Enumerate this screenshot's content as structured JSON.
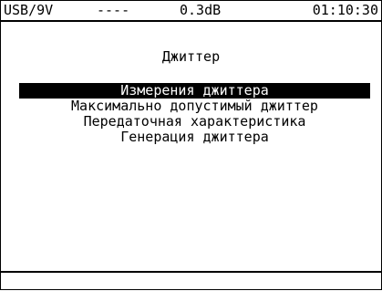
{
  "status": {
    "power": "USB/9V",
    "mode": "----",
    "level": "0.3dB",
    "time": "01:10:30"
  },
  "title": "Джиттер",
  "menu": [
    {
      "label": "Измерения джиттера",
      "selected": true
    },
    {
      "label": "Максимально допустимый джиттер",
      "selected": false
    },
    {
      "label": "Передаточная характеристика",
      "selected": false
    },
    {
      "label": "Генерация джиттера",
      "selected": false
    }
  ],
  "colors": {
    "foreground": "#000000",
    "background": "#ffffff"
  }
}
